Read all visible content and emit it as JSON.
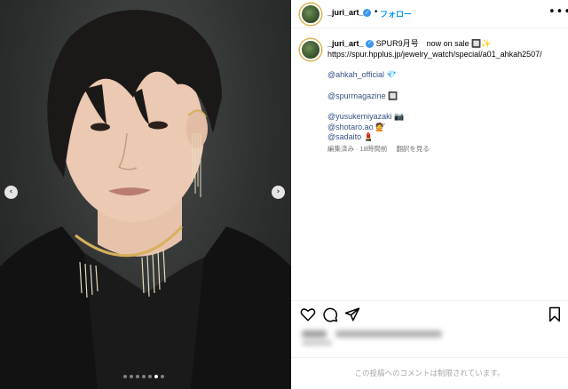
{
  "post": {
    "image_alt": "",
    "carousel": {
      "slide_count": 7,
      "active_index": 5
    }
  },
  "header": {
    "username": "_juri_art_",
    "separator": "•",
    "follow_label": "フォロー",
    "more_label": "•••"
  },
  "caption": {
    "username": "_juri_art_",
    "line1": "SPUR9月号　now on sale",
    "line1_emoji": "🔲✨",
    "url": "https://spur.hpplus.jp/jewelry_watch/special/a01_ahkah2507/",
    "mention_ahkah": "@ahkah_official",
    "mention_ahkah_emoji": "💎",
    "mention_spur": "@spurmagazine",
    "mention_spur_emoji": "🔲",
    "mention_yusuke": "@yusukemiyazaki",
    "mention_yusuke_emoji": "📷",
    "mention_shotaro": "@shotaro.ao",
    "mention_shotaro_emoji": "💇",
    "mention_sadaito": "@sadaito",
    "mention_sadaito_emoji": "💄"
  },
  "meta": {
    "edited": "編集済み",
    "dot": "·",
    "time": "18時間前",
    "translate": "翻訳を見る"
  },
  "restricted_text": "この投稿へのコメントは制限されています。",
  "colors": {
    "accent": "#0095f6",
    "verified": "#3897f0",
    "mention": "#385185"
  }
}
